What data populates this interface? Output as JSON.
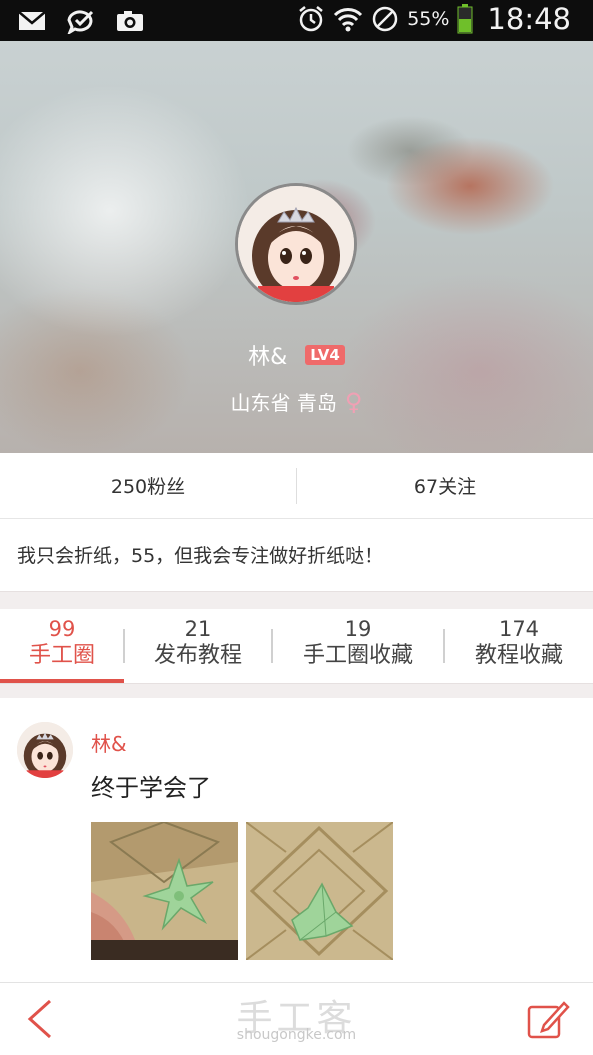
{
  "status_bar": {
    "battery": "55%",
    "time": "18:48"
  },
  "profile": {
    "name": "林&",
    "level": "LV4",
    "location": "山东省 青岛",
    "gender_symbol": "♀"
  },
  "stats": {
    "fans": "250粉丝",
    "following": "67关注"
  },
  "bio": "我只会折纸，55，但我会专注做好折纸哒！",
  "tabs": [
    {
      "count": "99",
      "label": "手工圈"
    },
    {
      "count": "21",
      "label": "发布教程"
    },
    {
      "count": "19",
      "label": "手工圈收藏"
    },
    {
      "count": "174",
      "label": "教程收藏"
    }
  ],
  "post": {
    "author": "林&",
    "text": "终于学会了"
  },
  "watermark": {
    "brand": "手工客",
    "domain": "shougongke.com"
  },
  "colors": {
    "accent": "#e0524a",
    "level_badge": "#ef6a6a",
    "gender": "#f0a0b4"
  }
}
